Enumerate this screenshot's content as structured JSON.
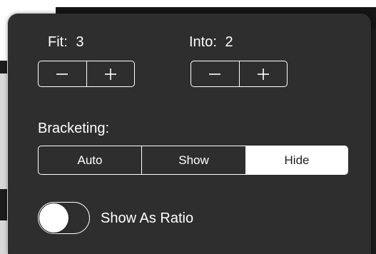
{
  "fit": {
    "label": "Fit:",
    "value": "3",
    "minus_icon": "minus-icon",
    "plus_icon": "plus-icon"
  },
  "into": {
    "label": "Into:",
    "value": "2",
    "minus_icon": "minus-icon",
    "plus_icon": "plus-icon"
  },
  "bracketing": {
    "label": "Bracketing:",
    "options": [
      "Auto",
      "Show",
      "Hide"
    ],
    "selected": "Hide"
  },
  "show_as_ratio": {
    "label": "Show As Ratio",
    "enabled": false
  },
  "colors": {
    "panel_background": "#2e2e2e",
    "foreground": "#ffffff",
    "selected_text": "#1f1f1f"
  }
}
